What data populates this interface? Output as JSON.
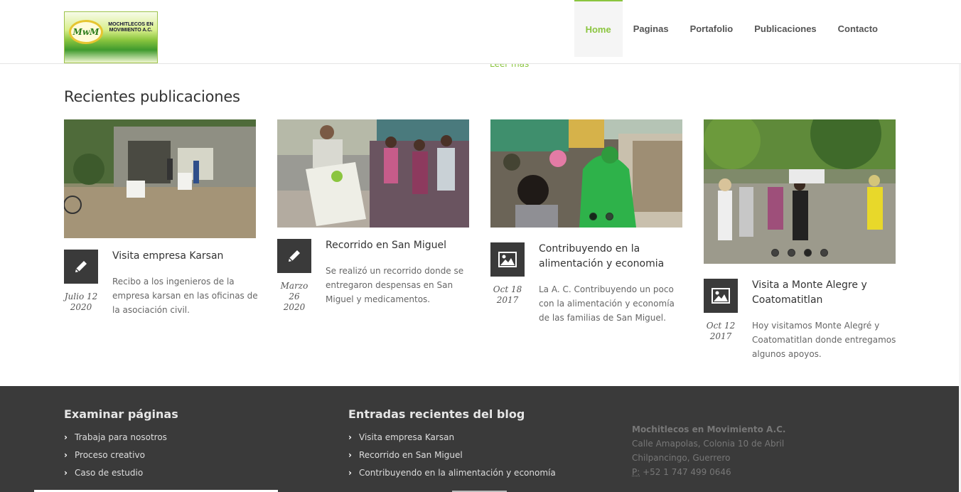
{
  "header": {
    "logo_text": "MOCHITLECOS EN MOVIMIENTO A.C.",
    "logo_emblem": "MwM",
    "nav": [
      {
        "label": "Home",
        "active": true
      },
      {
        "label": "Paginas",
        "active": false
      },
      {
        "label": "Portafolio",
        "active": false
      },
      {
        "label": "Publicaciones",
        "active": false
      },
      {
        "label": "Contacto",
        "active": false
      }
    ]
  },
  "partial_link": "Leer más",
  "section": {
    "title": "Recientes publicaciones"
  },
  "posts": [
    {
      "title": "Visita empresa Karsan",
      "date": "Julio 12 2020",
      "icon": "pencil-icon",
      "excerpt": "Recibo a los ingenieros de la empresa karsan en las oficinas de la asociación civil."
    },
    {
      "title": "Recorrido en San Miguel",
      "date": "Marzo 26 2020",
      "icon": "pencil-icon",
      "excerpt": "Se realizó un recorrido donde se entregaron despensas en San Miguel y medicamentos."
    },
    {
      "title": "Contribuyendo en la alimentación y economia",
      "date": "Oct 18 2017",
      "icon": "image-icon",
      "excerpt": "La A. C. Contribuyendo un poco con la alimentación y economía de las familias de San Miguel.",
      "slides": 2
    },
    {
      "title": "Visita a Monte Alegre y Coatomatitlan",
      "date": "Oct 12 2017",
      "icon": "image-icon",
      "excerpt": "Hoy visitamos Monte Alegré y Coatomatitlan donde entregamos algunos apoyos.",
      "slides": 4
    }
  ],
  "footer": {
    "col1": {
      "title": "Examinar páginas",
      "links": [
        "Trabaja para nosotros",
        "Proceso creativo",
        "Caso de estudio"
      ]
    },
    "col2": {
      "title": "Entradas recientes del blog",
      "links": [
        "Visita empresa Karsan",
        "Recorrido en San Miguel",
        "Contribuyendo en la alimentación y economía"
      ]
    },
    "contact": {
      "org": "Mochitlecos en Movimiento A.C.",
      "address1": "Calle Amapolas, Colonia 10 de Abril",
      "address2": "Chilpancingo, Guerrero",
      "phone_label": "P:",
      "phone": "+52 1 747 499 0646"
    }
  },
  "colors": {
    "accent": "#8bc53f",
    "footer_bg": "#3a3a3a",
    "icon_bg": "#3a3a3a"
  }
}
